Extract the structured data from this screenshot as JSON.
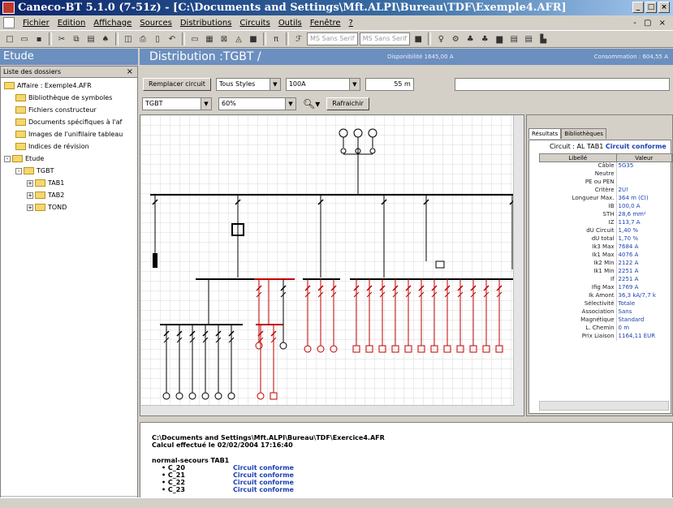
{
  "window": {
    "title": "Caneco-BT 5.1.0 (7-51z) - [C:\\Documents and Settings\\Mft.ALPI\\Bureau\\TDF\\Exemple4.AFR]"
  },
  "menu": {
    "items": [
      "Fichier",
      "Edition",
      "Affichage",
      "Sources",
      "Distributions",
      "Circuits",
      "Outils",
      "Fenêtre",
      "?"
    ],
    "mdi_controls": "- ▢ ×"
  },
  "toolbar": {
    "font_combo_1": "MS Sans Serif",
    "font_combo_2": "MS Sans Serif"
  },
  "headers": {
    "left": "Etude",
    "main": "Distribution :TGBT /",
    "dispo": "Disponibilité 1645,00 A",
    "conso": "Consommation : 604,55 A"
  },
  "left_panel": {
    "title": "Liste des dossiers",
    "tree": [
      {
        "label": "Affaire : Exemple4.AFR",
        "level": 0,
        "expander": ""
      },
      {
        "label": "Bibliothèque de symboles",
        "level": 1,
        "expander": ""
      },
      {
        "label": "Fichiers constructeur",
        "level": 1,
        "expander": ""
      },
      {
        "label": "Documents spécifiques à l'af",
        "level": 1,
        "expander": ""
      },
      {
        "label": "Images de l'unifilaire tableau",
        "level": 1,
        "expander": ""
      },
      {
        "label": "Indices de révision",
        "level": 1,
        "expander": ""
      },
      {
        "label": "Etude",
        "level": 0,
        "expander": "-"
      },
      {
        "label": "TGBT",
        "level": 1,
        "expander": "-"
      },
      {
        "label": "TAB1",
        "level": 2,
        "expander": "+"
      },
      {
        "label": "TAB2",
        "level": 2,
        "expander": "+"
      },
      {
        "label": "TOND",
        "level": 2,
        "expander": "+"
      }
    ]
  },
  "controls": {
    "replace_button": "Remplacer circuit",
    "style_select": "Tous Styles",
    "current_select": "100A",
    "length": "55 m",
    "board_select": "TGBT",
    "zoom_select": "60%",
    "refresh_button": "Rafraichir"
  },
  "results": {
    "tabs": [
      "Résultats",
      "Bibliothèques"
    ],
    "circuit": "Circuit : AL TAB1",
    "status": "Circuit conforme",
    "columns": [
      "Libellé",
      "Valeur"
    ],
    "rows": [
      {
        "label": "Câble",
        "value": "5G35"
      },
      {
        "label": "Neutre",
        "value": ""
      },
      {
        "label": "PE ou PEN",
        "value": ""
      },
      {
        "label": "Critère",
        "value": "2U!"
      },
      {
        "label": "Longueur Max.",
        "value": "364 m (CI)"
      },
      {
        "label": "IB",
        "value": "100,0 A"
      },
      {
        "label": "STH",
        "value": "28,6 mm²"
      },
      {
        "label": "IZ",
        "value": "113,7 A"
      },
      {
        "label": "dU Circuit",
        "value": "1,40 %"
      },
      {
        "label": "dU total",
        "value": "1,70 %"
      },
      {
        "label": "Ik3 Max",
        "value": "7684 A"
      },
      {
        "label": "Ik1 Max",
        "value": "4076 A"
      },
      {
        "label": "Ik2 Min",
        "value": "2122 A"
      },
      {
        "label": "Ik1 Min",
        "value": "2251 A"
      },
      {
        "label": "If",
        "value": "2251 A"
      },
      {
        "label": "Ifig Max",
        "value": "1769 A"
      },
      {
        "label": "Ik Amont",
        "value": "36,3 kA/7,7 k"
      },
      {
        "label": "Sélectivité",
        "value": "Totale"
      },
      {
        "label": "Association",
        "value": "Sans"
      },
      {
        "label": "Magnétique",
        "value": "Standard"
      },
      {
        "label": "L. Chemin",
        "value": "0 m"
      },
      {
        "label": "Prix Liaison",
        "value": "1164,11 EUR"
      }
    ]
  },
  "log": {
    "path": "C:\\Documents and Settings\\Mft.ALPI\\Bureau\\TDF\\Exercice4.AFR",
    "date": "Calcul effectué le 02/02/2004 17:16:40",
    "section": "normal-secours TAB1",
    "entries": [
      {
        "circuit": "• C_20",
        "status": "Circuit conforme"
      },
      {
        "circuit": "• C_21",
        "status": "Circuit conforme"
      },
      {
        "circuit": "• C_22",
        "status": "Circuit conforme"
      },
      {
        "circuit": "• C_23",
        "status": "Circuit conforme"
      }
    ]
  },
  "colors": {
    "header_blue": "#6b8fbf",
    "accent_red": "#c00000",
    "link_blue": "#1a3fb0"
  }
}
